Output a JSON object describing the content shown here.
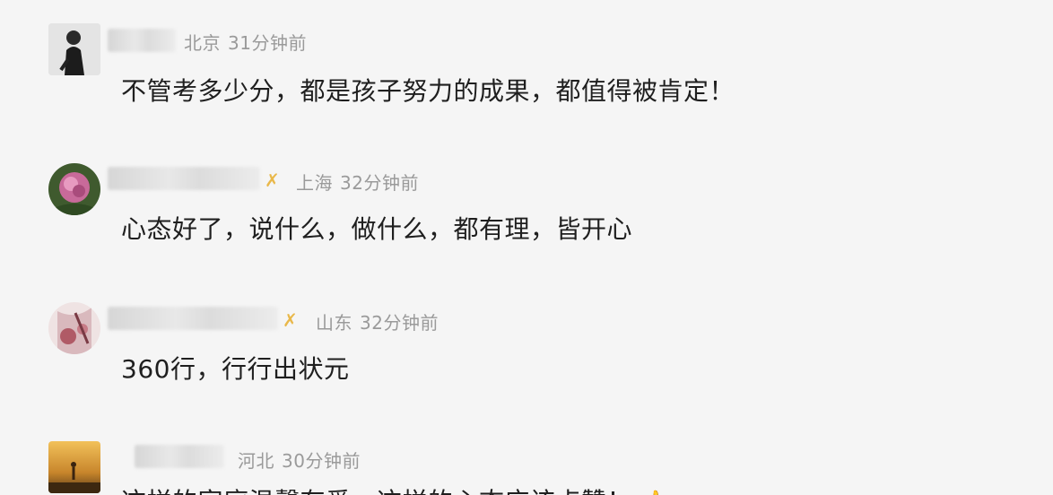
{
  "comments": [
    {
      "location": "北京",
      "time": "31分钟前",
      "text": "不管考多少分，都是孩子努力的成果，都值得被肯定！"
    },
    {
      "location": "上海",
      "time": "32分钟前",
      "text": "心态好了，说什么，做什么，都有理，皆开心"
    },
    {
      "location": "山东",
      "time": "32分钟前",
      "text": "360行，行行出状元"
    },
    {
      "location": "河北",
      "time": "30分钟前",
      "text": "这样的家庭温馨有爱，这样的心态应该点赞！"
    }
  ],
  "icons": {
    "badge": "vip-badge-icon",
    "emoji": "thumbs-up-emoji-icon"
  },
  "colors": {
    "background": "#f5f5f5",
    "meta_text": "#9a9a9a",
    "comment_text": "#1f1f1f",
    "badge": "#e9b84a"
  }
}
